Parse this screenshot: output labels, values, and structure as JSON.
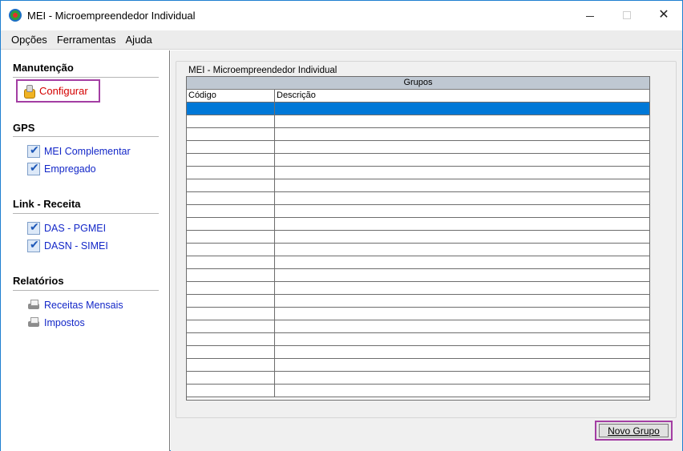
{
  "window": {
    "title": "MEI - Microempreendedor Individual"
  },
  "menu": [
    "Opções",
    "Ferramentas",
    "Ajuda"
  ],
  "sidebar": {
    "sections": [
      {
        "title": "Manutenção",
        "items": [
          {
            "label": "Configurar",
            "icon": "gear-icon"
          }
        ]
      },
      {
        "title": "GPS",
        "items": [
          {
            "label": "MEI Complementar",
            "icon": "check-icon"
          },
          {
            "label": "Empregado",
            "icon": "check-icon"
          }
        ]
      },
      {
        "title": "Link - Receita",
        "items": [
          {
            "label": "DAS - PGMEI",
            "icon": "check-icon"
          },
          {
            "label": "DASN - SIMEI",
            "icon": "check-icon"
          }
        ]
      },
      {
        "title": "Relatórios",
        "items": [
          {
            "label": "Receitas Mensais",
            "icon": "printer-icon"
          },
          {
            "label": "Impostos",
            "icon": "printer-icon"
          }
        ]
      }
    ]
  },
  "content": {
    "group_title": "MEI - Microempreendedor Individual",
    "grid": {
      "caption": "Grupos",
      "columns": [
        "Código",
        "Descrição"
      ],
      "selected_row": 0
    },
    "new_group_button": "Novo Grupo"
  },
  "colors": {
    "selection": "#0078d7",
    "highlight_border": "#a33ea3",
    "link": "#1327c8",
    "active_link": "#d40000"
  }
}
